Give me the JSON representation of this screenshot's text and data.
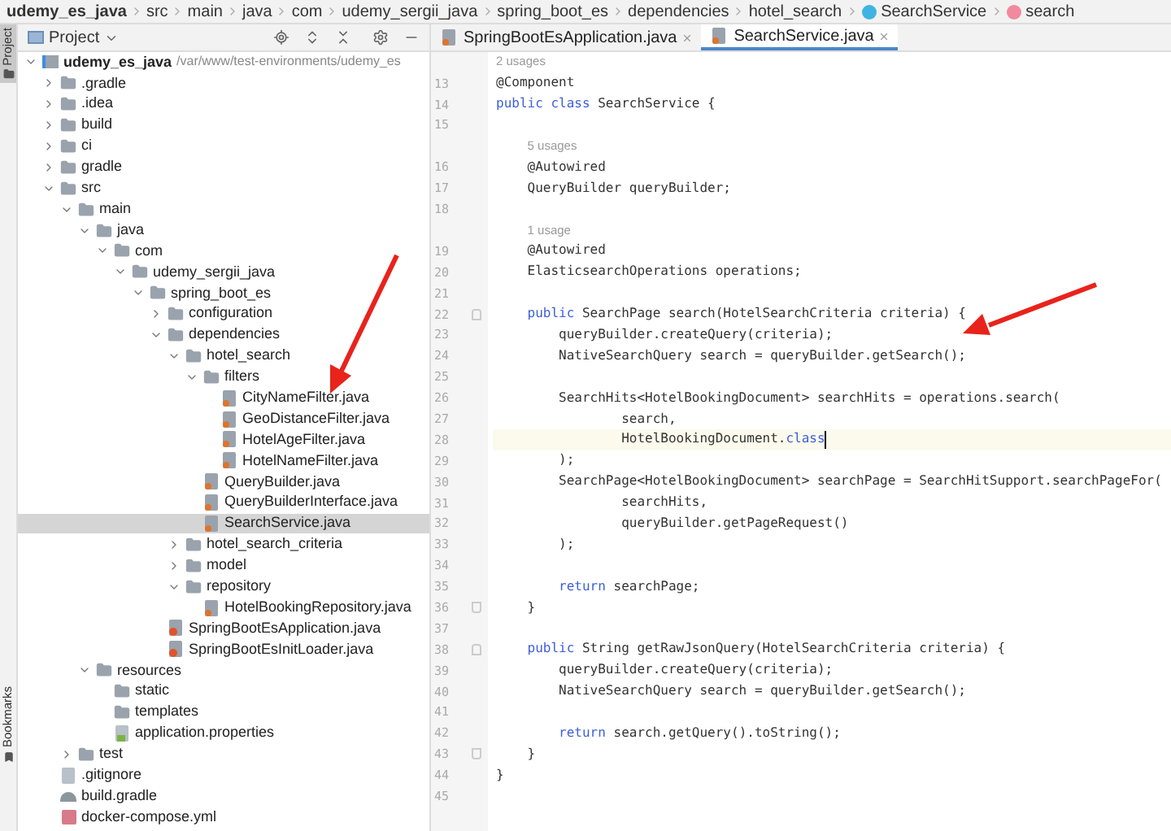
{
  "breadcrumb": [
    {
      "label": "udemy_es_java",
      "kind": "project"
    },
    {
      "label": "src",
      "kind": "folder"
    },
    {
      "label": "main",
      "kind": "folder"
    },
    {
      "label": "java",
      "kind": "folder"
    },
    {
      "label": "com",
      "kind": "folder"
    },
    {
      "label": "udemy_sergii_java",
      "kind": "folder"
    },
    {
      "label": "spring_boot_es",
      "kind": "folder"
    },
    {
      "label": "dependencies",
      "kind": "folder"
    },
    {
      "label": "hotel_search",
      "kind": "folder"
    },
    {
      "label": "SearchService",
      "kind": "class"
    },
    {
      "label": "search",
      "kind": "method"
    }
  ],
  "side_strip": {
    "top": {
      "label": "Project",
      "selected": true
    },
    "bottom": {
      "label": "Bookmarks",
      "selected": false
    }
  },
  "project_panel": {
    "title": "Project",
    "tree": [
      {
        "label": "udemy_es_java",
        "path": "/var/www/test-environments/udemy_es",
        "kind": "project",
        "expanded": true,
        "selected": false,
        "children": [
          {
            "label": ".gradle",
            "kind": "folder",
            "expanded": false,
            "selected": false
          },
          {
            "label": ".idea",
            "kind": "folder",
            "expanded": false,
            "selected": false
          },
          {
            "label": "build",
            "kind": "folder",
            "expanded": false,
            "selected": false
          },
          {
            "label": "ci",
            "kind": "folder",
            "expanded": false,
            "selected": false
          },
          {
            "label": "gradle",
            "kind": "folder",
            "expanded": false,
            "selected": false
          },
          {
            "label": "src",
            "kind": "folder",
            "expanded": true,
            "selected": false,
            "children": [
              {
                "label": "main",
                "kind": "folder",
                "expanded": true,
                "selected": false,
                "children": [
                  {
                    "label": "java",
                    "kind": "folder",
                    "expanded": true,
                    "selected": false,
                    "children": [
                      {
                        "label": "com",
                        "kind": "folder",
                        "expanded": true,
                        "selected": false,
                        "children": [
                          {
                            "label": "udemy_sergii_java",
                            "kind": "folder",
                            "expanded": true,
                            "selected": false,
                            "children": [
                              {
                                "label": "spring_boot_es",
                                "kind": "folder",
                                "expanded": true,
                                "selected": false,
                                "children": [
                                  {
                                    "label": "configuration",
                                    "kind": "folder",
                                    "expanded": false,
                                    "selected": false
                                  },
                                  {
                                    "label": "dependencies",
                                    "kind": "folder",
                                    "expanded": true,
                                    "selected": false,
                                    "children": [
                                      {
                                        "label": "hotel_search",
                                        "kind": "folder",
                                        "expanded": true,
                                        "selected": false,
                                        "children": [
                                          {
                                            "label": "filters",
                                            "kind": "folder",
                                            "expanded": true,
                                            "selected": false,
                                            "children": [
                                              {
                                                "label": "CityNameFilter.java",
                                                "kind": "java",
                                                "selected": false
                                              },
                                              {
                                                "label": "GeoDistanceFilter.java",
                                                "kind": "java",
                                                "selected": false
                                              },
                                              {
                                                "label": "HotelAgeFilter.java",
                                                "kind": "java",
                                                "selected": false
                                              },
                                              {
                                                "label": "HotelNameFilter.java",
                                                "kind": "java",
                                                "selected": false
                                              }
                                            ]
                                          },
                                          {
                                            "label": "QueryBuilder.java",
                                            "kind": "java",
                                            "selected": false
                                          },
                                          {
                                            "label": "QueryBuilderInterface.java",
                                            "kind": "java",
                                            "selected": false
                                          },
                                          {
                                            "label": "SearchService.java",
                                            "kind": "java",
                                            "selected": true
                                          }
                                        ]
                                      },
                                      {
                                        "label": "hotel_search_criteria",
                                        "kind": "folder",
                                        "expanded": false,
                                        "selected": false
                                      },
                                      {
                                        "label": "model",
                                        "kind": "folder",
                                        "expanded": false,
                                        "selected": false
                                      },
                                      {
                                        "label": "repository",
                                        "kind": "folder",
                                        "expanded": true,
                                        "selected": false,
                                        "children": [
                                          {
                                            "label": "HotelBookingRepository.java",
                                            "kind": "java",
                                            "selected": false
                                          }
                                        ]
                                      }
                                    ]
                                  },
                                  {
                                    "label": "SpringBootEsApplication.java",
                                    "kind": "java-app",
                                    "selected": false
                                  },
                                  {
                                    "label": "SpringBootEsInitLoader.java",
                                    "kind": "java-app",
                                    "selected": false
                                  }
                                ]
                              }
                            ]
                          }
                        ]
                      }
                    ]
                  },
                  {
                    "label": "resources",
                    "kind": "folder",
                    "expanded": true,
                    "selected": false,
                    "children": [
                      {
                        "label": "static",
                        "kind": "folder",
                        "selected": false
                      },
                      {
                        "label": "templates",
                        "kind": "folder",
                        "selected": false
                      },
                      {
                        "label": "application.properties",
                        "kind": "properties",
                        "selected": false
                      }
                    ]
                  }
                ]
              },
              {
                "label": "test",
                "kind": "folder",
                "expanded": false,
                "selected": false
              }
            ]
          },
          {
            "label": ".gitignore",
            "kind": "gitignore",
            "selected": false
          },
          {
            "label": "build.gradle",
            "kind": "gradle",
            "selected": false
          },
          {
            "label": "docker-compose.yml",
            "kind": "yml",
            "selected": false
          }
        ]
      }
    ]
  },
  "tabs": [
    {
      "label": "SpringBootEsApplication.java",
      "selected": false
    },
    {
      "label": "SearchService.java",
      "selected": true
    }
  ],
  "editor": {
    "rows": [
      {
        "kind": "hint",
        "text": "2 usages"
      },
      {
        "kind": "line",
        "number": "13",
        "current": false,
        "parts": [
          {
            "text": "@Component",
            "kind": "plain"
          }
        ]
      },
      {
        "kind": "line",
        "number": "14",
        "current": false,
        "parts": [
          {
            "text": "public class",
            "kind": "keyword"
          },
          {
            "text": " SearchService {",
            "kind": "plain"
          }
        ]
      },
      {
        "kind": "line",
        "number": "15",
        "current": false
      },
      {
        "kind": "hint",
        "text": "    5 usages"
      },
      {
        "kind": "line",
        "number": "16",
        "current": false,
        "parts": [
          {
            "text": "    @Autowired",
            "kind": "plain"
          }
        ]
      },
      {
        "kind": "line",
        "number": "17",
        "current": false,
        "parts": [
          {
            "text": "    QueryBuilder queryBuilder;",
            "kind": "plain"
          }
        ]
      },
      {
        "kind": "line",
        "number": "18",
        "current": false
      },
      {
        "kind": "hint",
        "text": "    1 usage"
      },
      {
        "kind": "line",
        "number": "19",
        "current": false,
        "parts": [
          {
            "text": "    @Autowired",
            "kind": "plain"
          }
        ]
      },
      {
        "kind": "line",
        "number": "20",
        "current": false,
        "parts": [
          {
            "text": "    ElasticsearchOperations operations;",
            "kind": "plain"
          }
        ]
      },
      {
        "kind": "line",
        "number": "21",
        "current": false
      },
      {
        "kind": "line",
        "number": "22",
        "current": false,
        "fold_start": true,
        "parts": [
          {
            "text": "    public",
            "kind": "keyword"
          },
          {
            "text": " SearchPage search(HotelSearchCriteria criteria) {",
            "kind": "plain"
          }
        ]
      },
      {
        "kind": "line",
        "number": "23",
        "current": false,
        "parts": [
          {
            "text": "        queryBuilder.createQuery(criteria);",
            "kind": "plain"
          }
        ]
      },
      {
        "kind": "line",
        "number": "24",
        "current": false,
        "parts": [
          {
            "text": "        NativeSearchQuery search = queryBuilder.getSearch();",
            "kind": "plain"
          }
        ]
      },
      {
        "kind": "line",
        "number": "25",
        "current": false
      },
      {
        "kind": "line",
        "number": "26",
        "current": false,
        "parts": [
          {
            "text": "        SearchHits<HotelBookingDocument> searchHits = operations.search(",
            "kind": "plain"
          }
        ]
      },
      {
        "kind": "line",
        "number": "27",
        "current": false,
        "parts": [
          {
            "text": "                search,",
            "kind": "plain"
          }
        ]
      },
      {
        "kind": "line",
        "number": "28",
        "current": true,
        "parts": [
          {
            "text": "                HotelBookingDocument.",
            "kind": "plain"
          },
          {
            "text": "class",
            "kind": "keyword"
          }
        ]
      },
      {
        "kind": "line",
        "number": "29",
        "current": false,
        "parts": [
          {
            "text": "        );",
            "kind": "plain"
          }
        ]
      },
      {
        "kind": "line",
        "number": "30",
        "current": false,
        "parts": [
          {
            "text": "        SearchPage<HotelBookingDocument> searchPage = SearchHitSupport.searchPageFor(",
            "kind": "plain"
          }
        ]
      },
      {
        "kind": "line",
        "number": "31",
        "current": false,
        "parts": [
          {
            "text": "                searchHits,",
            "kind": "plain"
          }
        ]
      },
      {
        "kind": "line",
        "number": "32",
        "current": false,
        "parts": [
          {
            "text": "                queryBuilder.getPageRequest()",
            "kind": "plain"
          }
        ]
      },
      {
        "kind": "line",
        "number": "33",
        "current": false,
        "parts": [
          {
            "text": "        );",
            "kind": "plain"
          }
        ]
      },
      {
        "kind": "line",
        "number": "34",
        "current": false
      },
      {
        "kind": "line",
        "number": "35",
        "current": false,
        "parts": [
          {
            "text": "        return",
            "kind": "keyword"
          },
          {
            "text": " searchPage;",
            "kind": "plain"
          }
        ]
      },
      {
        "kind": "line",
        "number": "36",
        "current": false,
        "fold_end": true,
        "parts": [
          {
            "text": "    }",
            "kind": "plain"
          }
        ]
      },
      {
        "kind": "line",
        "number": "37",
        "current": false
      },
      {
        "kind": "line",
        "number": "38",
        "current": false,
        "fold_start": true,
        "parts": [
          {
            "text": "    public",
            "kind": "keyword"
          },
          {
            "text": " String getRawJsonQuery(HotelSearchCriteria criteria) {",
            "kind": "plain"
          }
        ]
      },
      {
        "kind": "line",
        "number": "39",
        "current": false,
        "parts": [
          {
            "text": "        queryBuilder.createQuery(criteria);",
            "kind": "plain"
          }
        ]
      },
      {
        "kind": "line",
        "number": "40",
        "current": false,
        "parts": [
          {
            "text": "        NativeSearchQuery search = queryBuilder.getSearch();",
            "kind": "plain"
          }
        ]
      },
      {
        "kind": "line",
        "number": "41",
        "current": false
      },
      {
        "kind": "line",
        "number": "42",
        "current": false,
        "parts": [
          {
            "text": "        return",
            "kind": "keyword"
          },
          {
            "text": " search.getQuery().toString();",
            "kind": "plain"
          }
        ]
      },
      {
        "kind": "line",
        "number": "43",
        "current": false,
        "fold_end": true,
        "parts": [
          {
            "text": "    }",
            "kind": "plain"
          }
        ]
      },
      {
        "kind": "line",
        "number": "44",
        "current": false,
        "parts": [
          {
            "text": "}",
            "kind": "plain"
          }
        ]
      },
      {
        "kind": "line",
        "number": "45",
        "current": false
      }
    ]
  }
}
